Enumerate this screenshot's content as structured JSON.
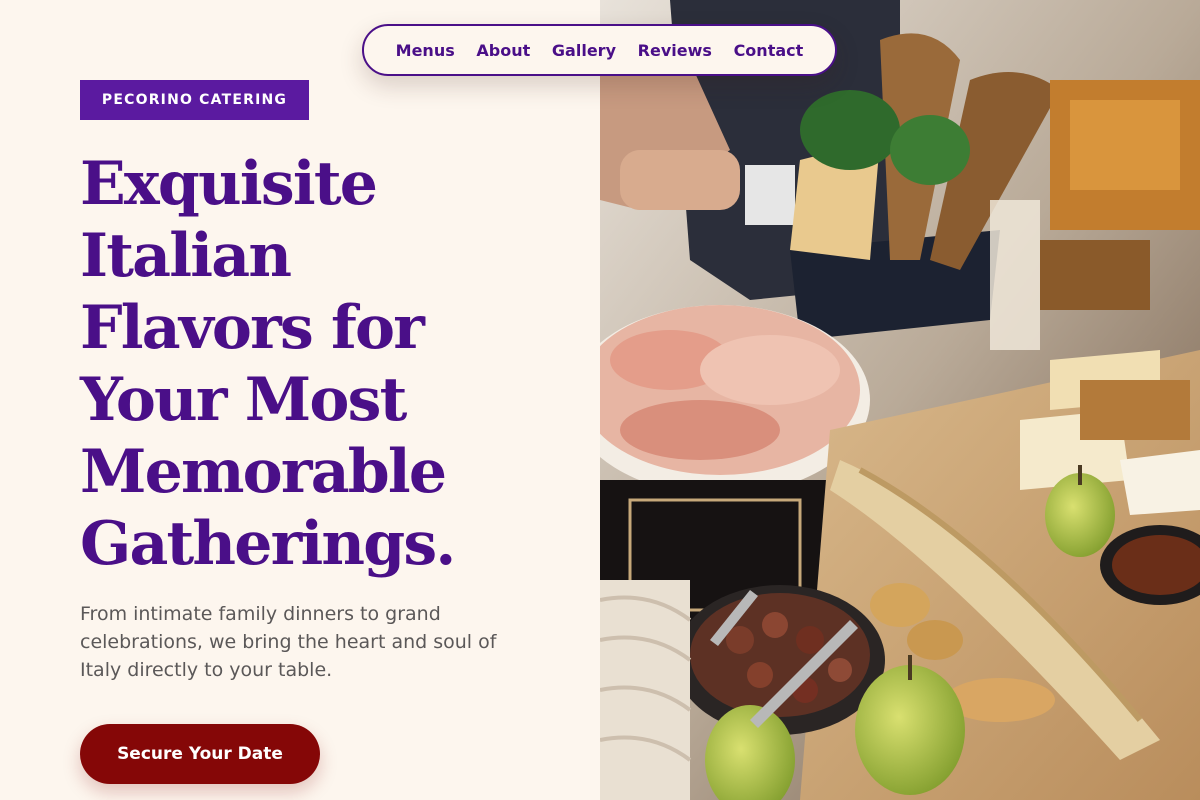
{
  "nav": {
    "items": [
      {
        "label": "Menus"
      },
      {
        "label": "About"
      },
      {
        "label": "Gallery"
      },
      {
        "label": "Reviews"
      },
      {
        "label": "Contact"
      }
    ]
  },
  "hero": {
    "badge": "PECORINO CATERING",
    "headline_lines": [
      "Exquisite",
      "Italian",
      "Flavors for",
      "Your Most",
      "Memorable",
      "Gatherings."
    ],
    "subtext_lines": [
      "From intimate family dinners to grand",
      "celebrations, we bring the heart and soul of",
      "Italy directly to your table."
    ],
    "cta_label": "Secure Your Date"
  },
  "colors": {
    "background": "#fdf6ee",
    "brand_purple": "#4a0f88",
    "badge_purple": "#5b1aa0",
    "cta_red": "#850707",
    "body_text": "#5b5858"
  }
}
